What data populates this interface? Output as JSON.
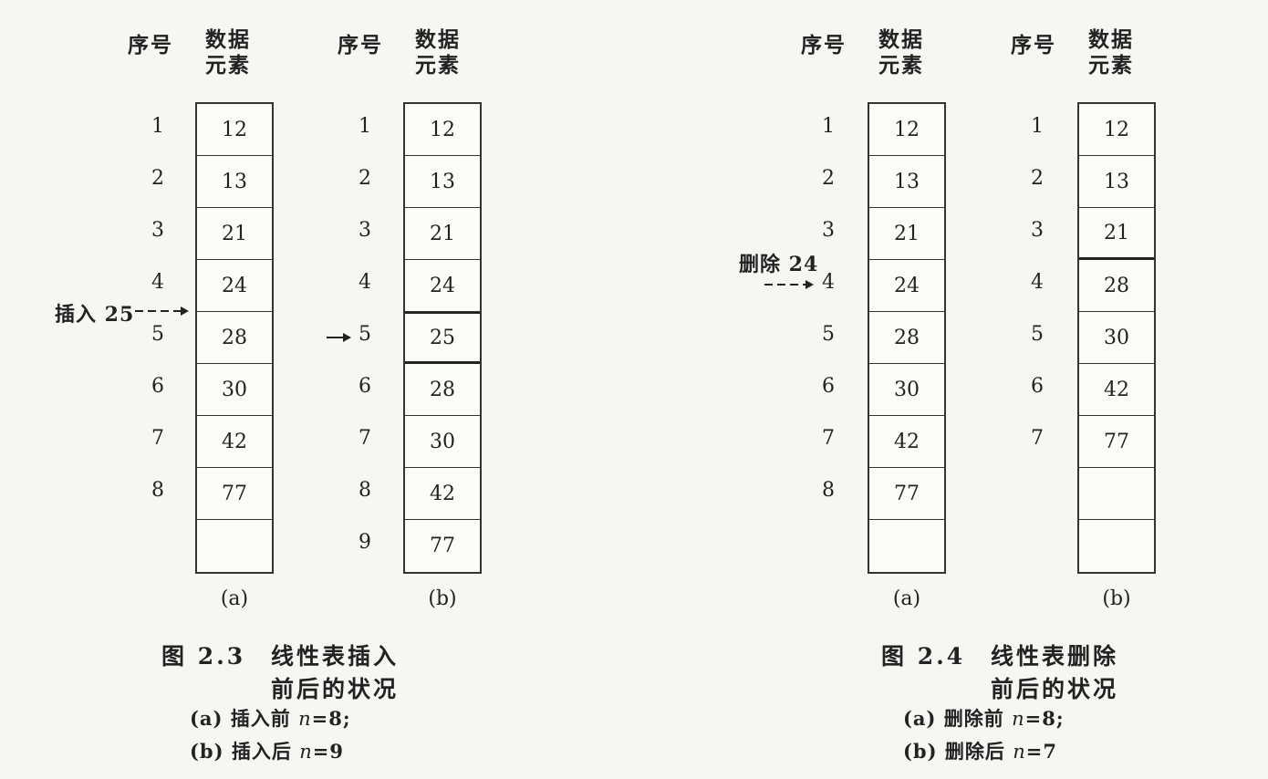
{
  "headers": {
    "seq": "序号",
    "data_line1": "数据",
    "data_line2": "元素"
  },
  "fig23": {
    "a": {
      "indices": [
        "1",
        "2",
        "3",
        "4",
        "5",
        "6",
        "7",
        "8"
      ],
      "values": [
        "12",
        "13",
        "21",
        "24",
        "28",
        "30",
        "42",
        "77",
        ""
      ],
      "label": "(a)"
    },
    "b": {
      "indices": [
        "1",
        "2",
        "3",
        "4",
        "5",
        "6",
        "7",
        "8",
        "9"
      ],
      "values": [
        "12",
        "13",
        "21",
        "24",
        "25",
        "28",
        "30",
        "42",
        "77"
      ],
      "label": "(b)"
    },
    "insert_annotation": "插入 25",
    "caption_num": "图 2.3",
    "caption_title_1": "线性表插入",
    "caption_title_2": "前后的状况",
    "note_a_prefix": "(a) 插入前 ",
    "note_a_var": "n",
    "note_a_suffix": "=8;",
    "note_b_prefix": "(b) 插入后 ",
    "note_b_var": "n",
    "note_b_suffix": "=9"
  },
  "fig24": {
    "a": {
      "indices": [
        "1",
        "2",
        "3",
        "4",
        "5",
        "6",
        "7",
        "8"
      ],
      "values": [
        "12",
        "13",
        "21",
        "24",
        "28",
        "30",
        "42",
        "77",
        ""
      ],
      "label": "(a)"
    },
    "b": {
      "indices": [
        "1",
        "2",
        "3",
        "4",
        "5",
        "6",
        "7"
      ],
      "values": [
        "12",
        "13",
        "21",
        "28",
        "30",
        "42",
        "77",
        "",
        ""
      ],
      "label": "(b)"
    },
    "delete_annotation": "删除 24",
    "caption_num": "图 2.4",
    "caption_title_1": "线性表删除",
    "caption_title_2": "前后的状况",
    "note_a_prefix": "(a) 删除前 ",
    "note_a_var": "n",
    "note_a_suffix": "=8;",
    "note_b_prefix": "(b) 删除后 ",
    "note_b_var": "n",
    "note_b_suffix": "=7"
  }
}
